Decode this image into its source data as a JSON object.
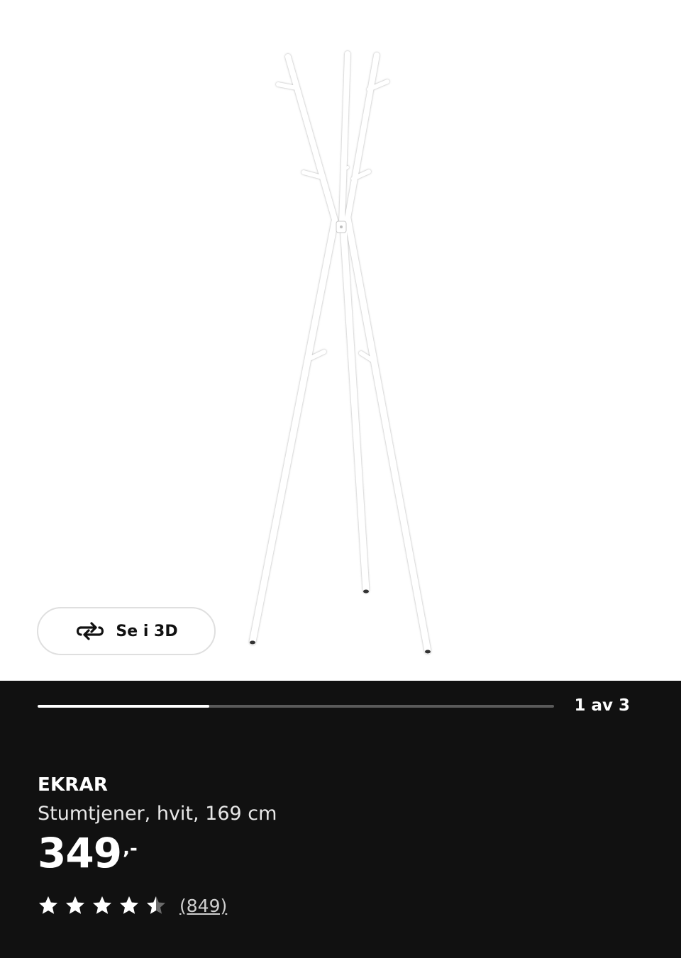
{
  "gallery": {
    "view_3d_label": "Se i 3D",
    "view_3d_icon": "rotate-3d-icon",
    "counter": "1 av 3",
    "current_slide": 1,
    "total_slides": 3,
    "progress_fraction": 0.333
  },
  "product": {
    "name": "EKRAR",
    "description": "Stumtjener, hvit, 169 cm",
    "price_integer": "349",
    "price_suffix": ",-",
    "rating_value": 4.5,
    "rating_max": 5,
    "review_count": "(849)",
    "star_icon": "star-icon"
  },
  "colors": {
    "panel_background": "#111111",
    "image_background": "#ffffff",
    "text_primary": "#ffffff",
    "progress_track": "#5a5a5a",
    "progress_fill": "#ffffff"
  }
}
